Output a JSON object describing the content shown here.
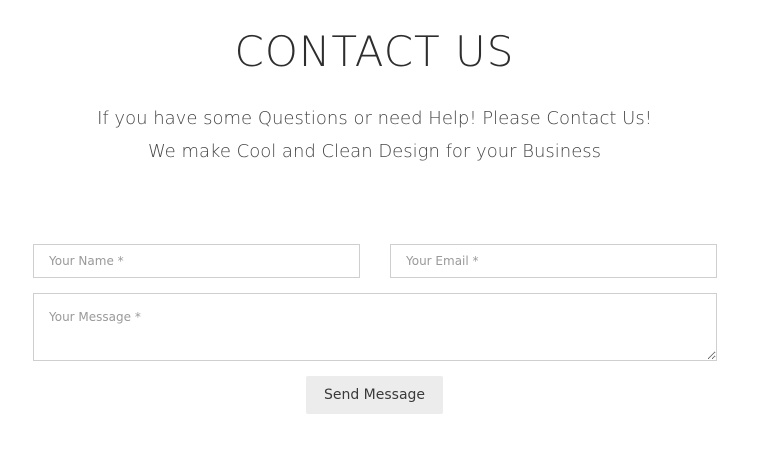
{
  "header": {
    "title": "CONTACT US",
    "subtitle_line1": "If you have some Questions or need Help! Please Contact Us!",
    "subtitle_line2": "We make Cool and Clean Design for your Business"
  },
  "form": {
    "name": {
      "placeholder": "Your Name *",
      "value": ""
    },
    "email": {
      "placeholder": "Your Email *",
      "value": ""
    },
    "message": {
      "placeholder": "Your Message *",
      "value": ""
    },
    "submit_label": "Send Message"
  },
  "colors": {
    "background": "#ffffff",
    "text": "#333333",
    "field_border": "#cfcfcf",
    "button_bg": "#ececec"
  }
}
